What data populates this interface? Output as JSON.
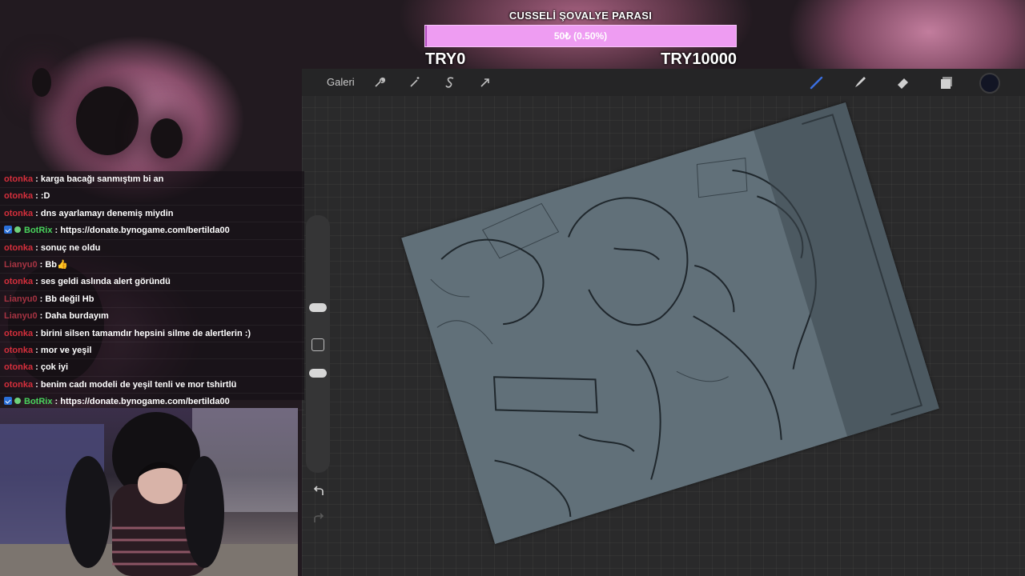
{
  "donation_goal": {
    "title": "CUSSELİ ŞOVALYE PARASI",
    "amount": "50₺ (0.50%)",
    "progress_percent": 0.5,
    "min_label": "TRY0",
    "max_label": "TRY10000",
    "bar_color": "#ee9cf2"
  },
  "toolbar": {
    "gallery_label": "Galeri",
    "left_icons": [
      "wrench-icon",
      "magic-wand-icon",
      "selection-s-icon",
      "transform-arrow-icon"
    ],
    "right_icons": [
      "brush-icon",
      "smudge-icon",
      "eraser-icon",
      "layers-icon"
    ],
    "active_tool": "brush-icon",
    "active_tool_color": "#3b6fe0",
    "current_color": "#121524"
  },
  "chat": {
    "messages": [
      {
        "user": "otonka",
        "text": "karga bacağı sanmıştım bi an",
        "style": "red"
      },
      {
        "user": "otonka",
        "text": ":D",
        "style": "red"
      },
      {
        "user": "otonka",
        "text": "dns ayarlamayı denemiş miydin",
        "style": "red"
      },
      {
        "user": "BotRix",
        "text": "https://donate.bynogame.com/bertilda00",
        "style": "bot"
      },
      {
        "user": "otonka",
        "text": "sonuç ne oldu",
        "style": "red"
      },
      {
        "user": "Lianyu0",
        "text": "Bb👍",
        "style": "faded"
      },
      {
        "user": "otonka",
        "text": "ses geldi aslında alert göründü",
        "style": "red"
      },
      {
        "user": "Lianyu0",
        "text": "Bb değil Hb",
        "style": "faded"
      },
      {
        "user": "Lianyu0",
        "text": "Daha burdayım",
        "style": "faded"
      },
      {
        "user": "otonka",
        "text": "birini silsen tamamdır hepsini silme de alertlerin :)",
        "style": "red"
      },
      {
        "user": "otonka",
        "text": "mor ve yeşil",
        "style": "red"
      },
      {
        "user": "otonka",
        "text": "çok iyi",
        "style": "red"
      },
      {
        "user": "otonka",
        "text": "benim cadı modeli de yeşil tenli ve mor tshirtlü",
        "style": "red"
      },
      {
        "user": "BotRix",
        "text": "https://donate.bynogame.com/bertilda00",
        "style": "bot"
      }
    ]
  }
}
